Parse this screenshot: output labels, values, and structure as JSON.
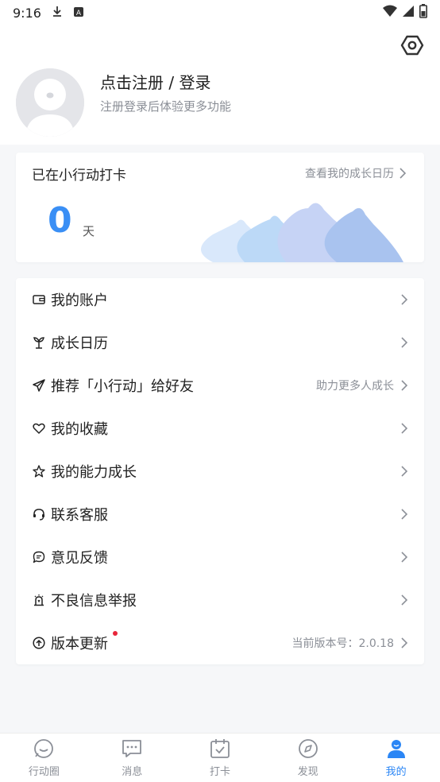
{
  "status_bar": {
    "time": "9:16",
    "icons": [
      "download-icon",
      "a-notification-icon",
      "wifi-icon",
      "signal-icon",
      "battery-icon"
    ]
  },
  "profile": {
    "title": "点击注册 / 登录",
    "subtitle": "注册登录后体验更多功能",
    "settings_icon": "hexagon-settings-icon"
  },
  "checkin": {
    "title": "已在小行动打卡",
    "link_label": "查看我的成长日历",
    "days": "0",
    "days_unit": "天"
  },
  "menu": {
    "items": [
      {
        "label": "我的账户",
        "icon": "wallet-icon",
        "right": ""
      },
      {
        "label": "成长日历",
        "icon": "sprout-icon",
        "right": ""
      },
      {
        "label": "推荐「小行动」给好友",
        "icon": "send-icon",
        "right": "助力更多人成长"
      },
      {
        "label": "我的收藏",
        "icon": "heart-icon",
        "right": ""
      },
      {
        "label": "我的能力成长",
        "icon": "star-icon",
        "right": ""
      },
      {
        "label": "联系客服",
        "icon": "headset-icon",
        "right": ""
      },
      {
        "label": "意见反馈",
        "icon": "feedback-icon",
        "right": ""
      },
      {
        "label": "不良信息举报",
        "icon": "alarm-icon",
        "right": ""
      },
      {
        "label": "版本更新",
        "icon": "upload-icon",
        "right": "当前版本号：2.0.18"
      }
    ]
  },
  "tabs": [
    {
      "label": "行动圈",
      "icon": "circle-chat-icon",
      "active": false
    },
    {
      "label": "消息",
      "icon": "message-icon",
      "active": false
    },
    {
      "label": "打卡",
      "icon": "calendar-check-icon",
      "active": false
    },
    {
      "label": "发现",
      "icon": "compass-icon",
      "active": false
    },
    {
      "label": "我的",
      "icon": "person-icon",
      "active": true
    }
  ],
  "colors": {
    "accent": "#2b86f5",
    "days_number": "#3a8ff5",
    "badge_dot": "#e8263a",
    "secondary_text": "#8b8f97"
  }
}
